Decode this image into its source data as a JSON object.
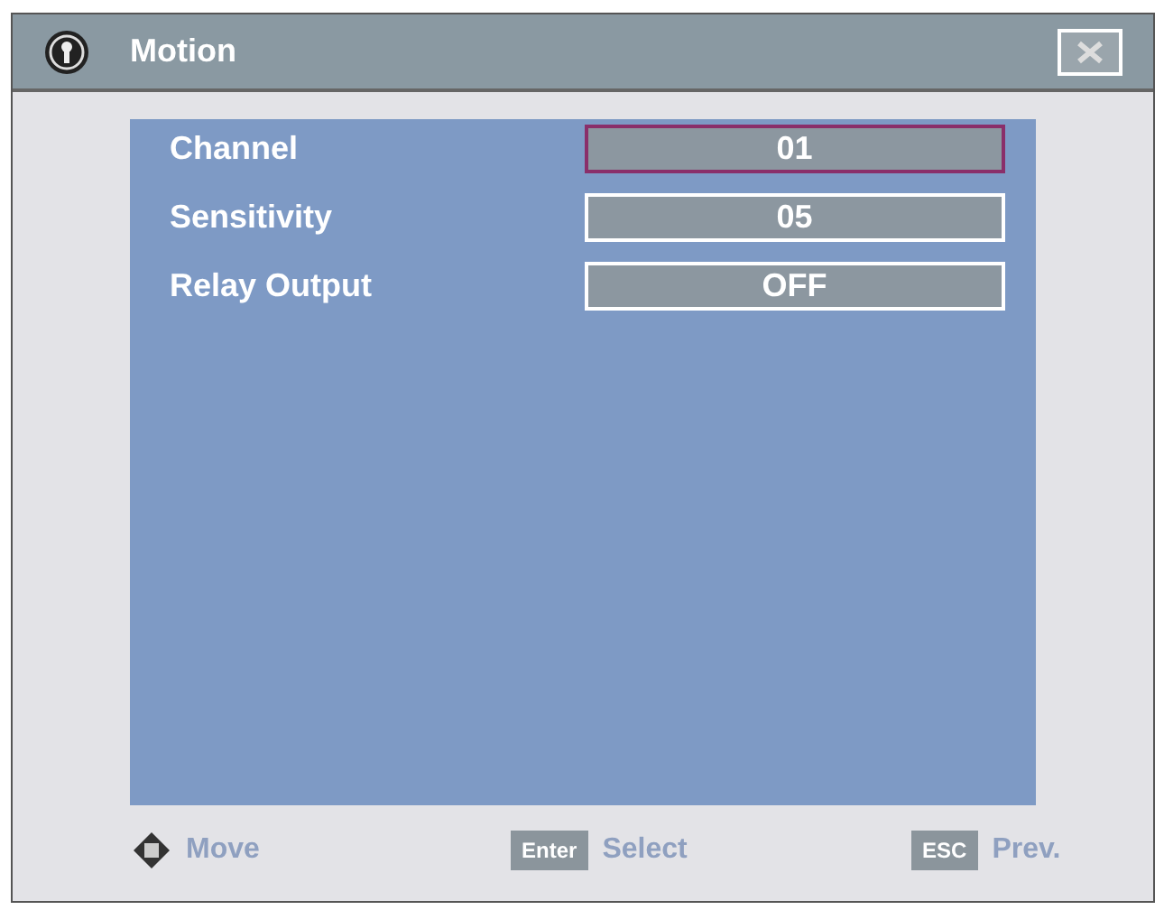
{
  "window": {
    "title": "Motion"
  },
  "settings": [
    {
      "label": "Channel",
      "value": "01",
      "selected": true
    },
    {
      "label": "Sensitivity",
      "value": "05",
      "selected": false
    },
    {
      "label": "Relay Output",
      "value": "OFF",
      "selected": false
    }
  ],
  "footer": [
    {
      "kind": "dpad",
      "text": "Move"
    },
    {
      "kind": "key",
      "key": "Enter",
      "text": "Select"
    },
    {
      "kind": "key",
      "key": "ESC",
      "text": "Prev."
    }
  ]
}
